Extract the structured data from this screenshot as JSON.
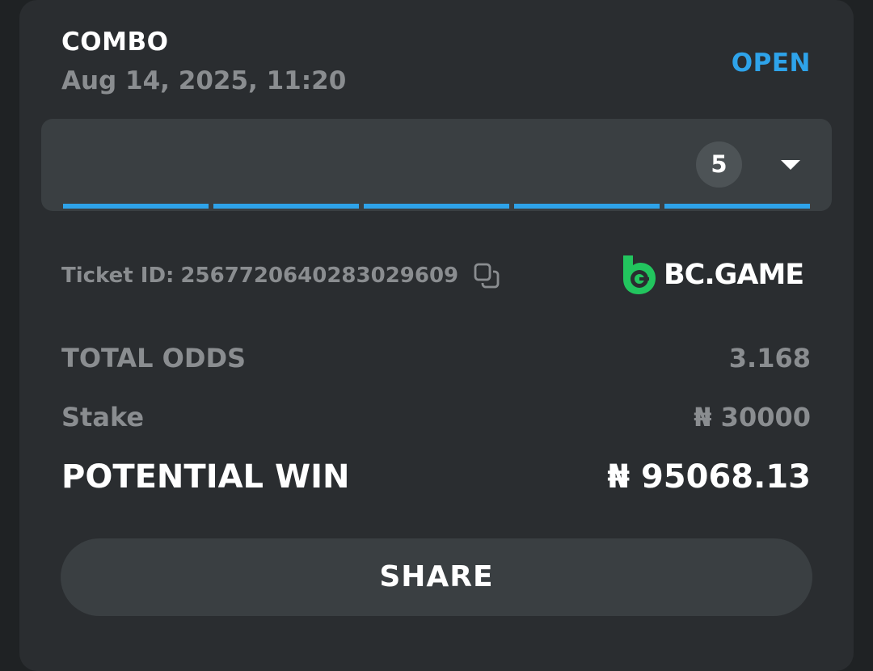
{
  "header": {
    "bet_type": "COMBO",
    "date": "Aug 14, 2025, 11:20",
    "status": "OPEN",
    "status_color": "#2ea3ea"
  },
  "selections": {
    "count": "5",
    "progress_segments": 5,
    "progress_filled": 5,
    "dropdown_icon": "caret-down-icon"
  },
  "ticket": {
    "label": "Ticket ID:",
    "id": "2567720640283029609",
    "copy_icon": "copy-icon"
  },
  "brand": {
    "name": "BC.GAME",
    "logo_color": "#22c55e"
  },
  "summary": {
    "total_odds_label": "TOTAL ODDS",
    "total_odds_value": "3.168",
    "stake_label": "Stake",
    "stake_value": "₦ 30000",
    "potential_win_label": "POTENTIAL WIN",
    "potential_win_value": "₦ 95068.13"
  },
  "actions": {
    "share_label": "SHARE"
  }
}
